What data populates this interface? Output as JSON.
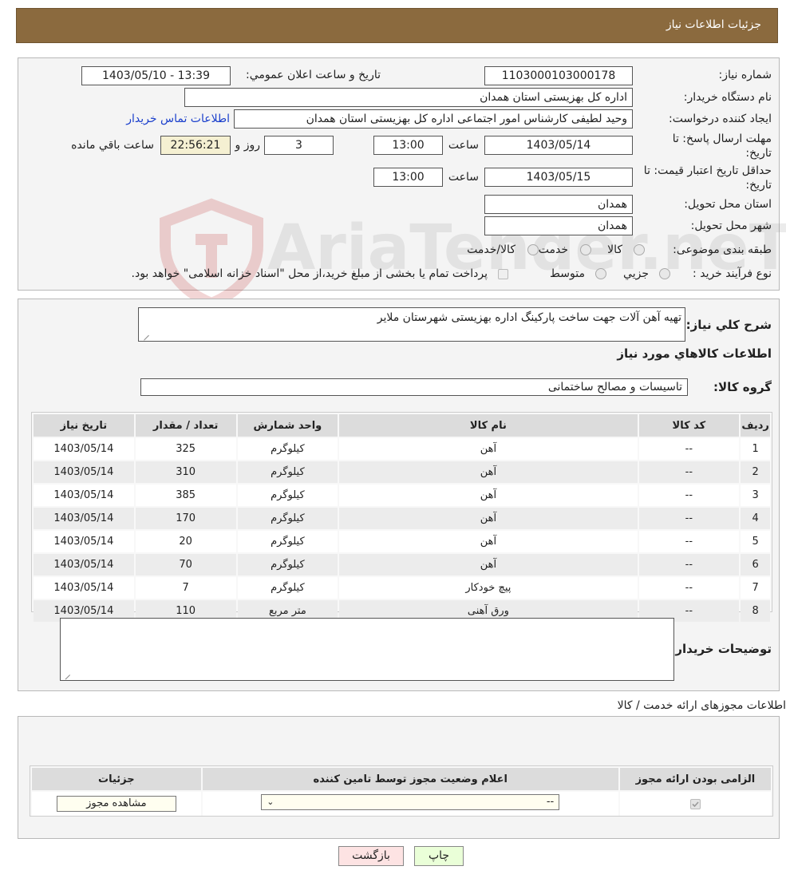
{
  "header": {
    "title": "جزئیات اطلاعات نیاز"
  },
  "info": {
    "need_number_label": "شماره نیاز:",
    "need_number": "1103000103000178",
    "announce_label": "تاریخ و ساعت اعلان عمومي:",
    "announce_value": "1403/05/10 - 13:39",
    "buyer_label": "نام دستگاه خریدار:",
    "buyer_value": "اداره کل بهزیستی استان همدان",
    "creator_label": "ایجاد کننده درخواست:",
    "creator_value": "وحید لطیفی کارشناس امور اجتماعی اداره کل بهزیستی استان همدان",
    "contact_link": "اطلاعات تماس خریدار",
    "deadline_label_1": "مهلت ارسال پاسخ: تا",
    "deadline_label_2": "تاریخ:",
    "deadline_date": "1403/05/14",
    "time_label": "ساعت",
    "deadline_time": "13:00",
    "days_value": "3",
    "days_label": "روز و",
    "remaining_time": "22:56:21",
    "remaining_label": "ساعت باقي مانده",
    "validity_label_1": "حداقل تاریخ اعتبار قیمت: تا",
    "validity_label_2": "تاریخ:",
    "validity_date": "1403/05/15",
    "validity_time": "13:00",
    "province_label": "استان محل تحویل:",
    "province_value": "همدان",
    "city_label": "شهر محل تحویل:",
    "city_value": "همدان",
    "category_label": "طبقه بندی موضوعی:",
    "category_options": [
      "کالا",
      "خدمت",
      "کالا/خدمت"
    ],
    "process_label": "نوع فرآیند خرید :",
    "process_options": [
      "جزیي",
      "متوسط"
    ],
    "process_note": "پرداخت تمام یا بخشی از مبلغ خرید،از محل \"اسناد خزانه اسلامی\" خواهد بود."
  },
  "description": {
    "label": "شرح کلي نیاز:",
    "value": "تهیه آهن آلات جهت ساخت پارکینگ اداره بهزیستی شهرستان ملایر"
  },
  "goods": {
    "section_title": "اطلاعات کالاهاي مورد نیاز",
    "group_label": "گروه کالا:",
    "group_value": "تاسیسات و مصالح ساختمانی",
    "columns": [
      "ردیف",
      "کد کالا",
      "نام کالا",
      "واحد شمارش",
      "تعداد / مقدار",
      "تاریخ نیاز"
    ],
    "rows": [
      {
        "n": "1",
        "code": "--",
        "name": "آهن",
        "unit": "کیلوگرم",
        "qty": "325",
        "date": "1403/05/14"
      },
      {
        "n": "2",
        "code": "--",
        "name": "آهن",
        "unit": "کیلوگرم",
        "qty": "310",
        "date": "1403/05/14"
      },
      {
        "n": "3",
        "code": "--",
        "name": "آهن",
        "unit": "کیلوگرم",
        "qty": "385",
        "date": "1403/05/14"
      },
      {
        "n": "4",
        "code": "--",
        "name": "آهن",
        "unit": "کیلوگرم",
        "qty": "170",
        "date": "1403/05/14"
      },
      {
        "n": "5",
        "code": "--",
        "name": "آهن",
        "unit": "کیلوگرم",
        "qty": "20",
        "date": "1403/05/14"
      },
      {
        "n": "6",
        "code": "--",
        "name": "آهن",
        "unit": "کیلوگرم",
        "qty": "70",
        "date": "1403/05/14"
      },
      {
        "n": "7",
        "code": "--",
        "name": "پیچ خودکار",
        "unit": "کیلوگرم",
        "qty": "7",
        "date": "1403/05/14"
      },
      {
        "n": "8",
        "code": "--",
        "name": "ورق آهنی",
        "unit": "متر مربع",
        "qty": "110",
        "date": "1403/05/14"
      }
    ],
    "buyer_notes_label": "توضیحات خریدار:",
    "buyer_notes_value": ""
  },
  "permits": {
    "section_title": "اطلاعات مجوزهای ارائه خدمت / کالا",
    "columns": [
      "الزامی بودن ارائه مجوز",
      "اعلام وضعیت مجوز توسط تامین کننده",
      "جزئیات"
    ],
    "select_value": "--",
    "view_button": "مشاهده مجوز"
  },
  "footer": {
    "print_button": "چاپ",
    "back_button": "بازگشت"
  },
  "watermark": "AriaTender.neT",
  "colors": {
    "header_bg": "#8b6a3e",
    "link": "#1a3fcc",
    "back_bg": "#fde3e3",
    "print_bg": "#eaffd8",
    "remaining_bg": "#f5f0d2"
  }
}
